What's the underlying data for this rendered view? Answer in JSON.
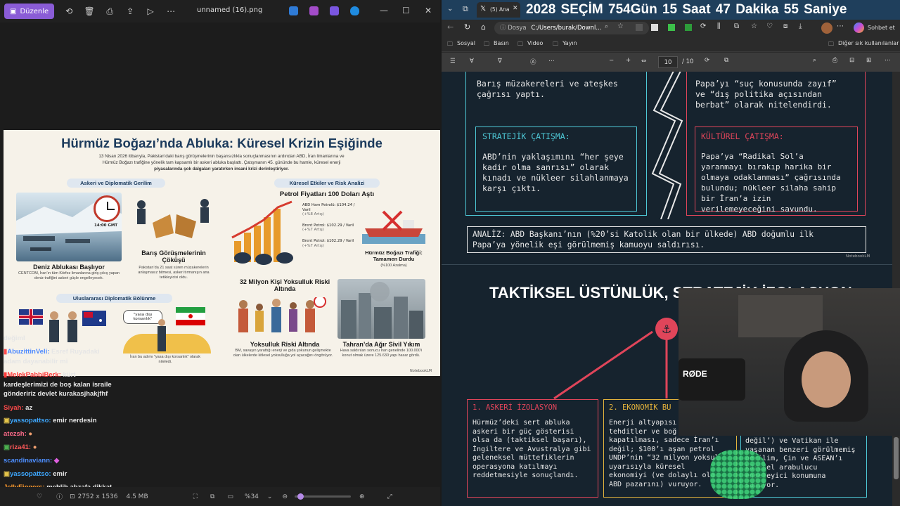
{
  "photos": {
    "edit_label": "Düzenle",
    "file_title": "unnamed (16).png",
    "dimensions": "2752 x 1536",
    "size": "4.5 MB",
    "zoom": "%34",
    "zoom_fraction": 0.05
  },
  "infographic": {
    "title": "Hürmüz Boğazı’nda Abluka: Küresel Krizin Eşiğinde",
    "subtitle_1": "13 Nisan 2026 itibarıyla, Pakistan’daki barış görüşmelerinin başarısızlıkla sonuçlanmasının ardından ABD, İran limanlarına ve",
    "subtitle_2": "Hürmüz Boğazı trafiğine yönelik tam kapsamlı bir askeri abluka başlattı. Çatışmanın 45. gününde bu hamle, küresel enerji",
    "subtitle_3": "piyasalarında şok dalgaları yaratırken insani krizi derinleştiriyor.",
    "section_military": "Askeri ve Diplomatik Gerilim",
    "section_global": "Küresel Etkiler ve Risk Analizi",
    "oil_title": "Petrol Fiyatları 100 Doları Aştı",
    "blockade_caption": "Deniz Ablukası Başlıyor",
    "blockade_text": "CENTCOM, İran’ın tüm Körfez limanlarına giriş-çıkış yapan deniz trafiğini askeri güçle engelleyecek.",
    "clock_time": "14:00 GMT",
    "talks_caption": "Barış Görüşmelerinin Çöküşü",
    "talks_text": "Pakistan’da 21 saat süren müzakerelerin anlaşmasız bitmesi, askeri tırmanışın ana tetikleyicisi oldu.",
    "wti": "ABD Ham Petrolü: $104.24 / Varil",
    "wti_change": "(+%8 Artış)",
    "brent1": "Brent Petrol: $102.29 / Varil",
    "brent1_change": "(+%7 Artış)",
    "brent2": "Brent Petrol: $102.29 / Varil",
    "brent2_change": "(+%7 Artış)",
    "traffic_caption": "Hürmüz Boğazı Trafiği: Tamamen Durdu",
    "traffic_text": "(%100 Azalma)",
    "section_diplomacy": "Uluslararası Diplomatik Bölünme",
    "piracy_bubble": "\"yasa dışı korsanlık\"",
    "piracy_text": "İran bu adımı \"yasa dışı korsanlık\" olarak niteledi.",
    "allies_text": "İngiltere ve Avustralya ablukaya katılmayı reddederken",
    "poverty_title": "32 Milyon Kişi Yoksulluk Riski Altında",
    "poverty_caption": "Yoksulluk Riski Altında",
    "poverty_text": "BM, savaşın yarattığı enerji ve gıda şokunun gelişmekte olan ülkelerde kitlesel yoksulluğa yol açacağını öngörüyor.",
    "tehran_caption": "Tahran’da Ağır Sivil Yıkım",
    "tehran_text": "Hava saldırıları sonucu İran genelinde 100.000’i konut olmak üzere 125.630 yapı hasar gördü.",
    "watermark": "NotebookLM"
  },
  "chat": [
    {
      "user": "",
      "text": "değiml",
      "color": "#ffffff"
    },
    {
      "user": "AbuzittinVeli:",
      "text": "Esref Ruyadaki",
      "color": "#f0f0f0",
      "ucolor": "#4f8bff"
    },
    {
      "user": "",
      "text": "adam dayanabilir mi",
      "color": "#ffffff"
    },
    {
      "user": "MelekPabbiBerk:",
      "text": "kürt",
      "color": "#ffffff",
      "ucolor": "#ff3b3b"
    },
    {
      "user": "",
      "text": "kardeşlerimizi de boş kalan israile",
      "color": "#ffffff"
    },
    {
      "user": "",
      "text": "göndeririz devlet kurakasjhakjfhf",
      "color": "#ffffff"
    },
    {
      "user": "Siyah:",
      "text": "az",
      "color": "#ffffff",
      "ucolor": "#ff4a4a"
    },
    {
      "user": "yassopattso:",
      "text": "emir nerdesin",
      "color": "#ffffff",
      "ucolor": "#3ea8ff"
    },
    {
      "user": "atezsh:",
      "text": "",
      "color": "#ffffff",
      "ucolor": "#ff6b8a"
    },
    {
      "user": "riza41:",
      "text": "",
      "color": "#ffffff",
      "ucolor": "#ff5959"
    },
    {
      "user": "scandinaviann:",
      "text": "",
      "color": "#ffffff",
      "ucolor": "#4d8eff"
    },
    {
      "user": "yassopattso:",
      "text": "emir",
      "color": "#ffffff",
      "ucolor": "#3ea8ff"
    },
    {
      "user": "JellyFingers:",
      "text": "mehlih abzafa dikkat",
      "color": "#ffffff",
      "ucolor": "#ff9a2e"
    },
    {
      "user": "",
      "text": "edin",
      "color": "#ffffff"
    }
  ],
  "browser": {
    "tab_label": "(5) Ana",
    "countdown": "2028 SEÇİM 754Gün 15 Saat 47 Dakika 55 Saniye",
    "address_prefix": "Dosya",
    "address": "C:/Users/burak/Downl...",
    "copilot": "Sohbet et",
    "favorites": [
      "Sosyal",
      "Basın",
      "Video",
      "Yayın"
    ],
    "other_favorites": "Diğer sık kullanılanlar",
    "page_current": "10",
    "page_total": "/ 10"
  },
  "pdf": {
    "top_left_text": "Barış müzakereleri ve ateşkes\nçağrısı yaptı.",
    "top_right_text": "Papa’yı “suç konusunda zayıf”\nve “dış politika açısından\nberbat” olarak nitelendirdi.",
    "strategic_title": "STRATEJİK ÇATIŞMA:",
    "strategic_text": "ABD’nin yaklaşımını “her şeye\nkadir olma sanrısı” olarak\nkınadı ve nükleer silahlanmaya\nkarşı çıktı.",
    "cultural_title": "KÜLTÜREL ÇATIŞMA:",
    "cultural_text": "Papa’ya “Radikal Sol’a\nyaranmayı bırakıp harika bir\nolmaya odaklanması” çağrısında\nbulundu; nükleer silaha sahip\nbir İran’a izin\nverilemeyeceğini savundu.",
    "analysis_text": "ANALİZ: ABD Başkanı’nın (%20’si Katolik olan bir ülkede) ABD doğumlu ilk\nPapa’ya yönelik eşi görülmemiş kamuoyu saldırısı.",
    "section2_title": "TAKTİKSEL ÜSTÜNLÜK, STRATEJİK İZOLASYON",
    "col1_title": "1. ASKERİ İZOLASYON",
    "col1_text": "Hürmüz’deki sert abluka\naskeri bir güç gösterisi\nolsa da (taktiksel başarı),\nİngiltere ve Avustralya gibi\ngeleneksel müttefiklerin\noperasyona katılmayı\nreddetmesiyle sonuçlandı.",
    "col2_title": "2. EKONOMİK BU",
    "col2_text": "Enerji altyapısı\ntehditler ve boğ\nkapatılması, sadece İran’ı\ndeğil; $100’ı aşan petrol\nUNDP’nin “32 milyon yoksul\nuyarısıyla küresel\nekonomiyi (ve dolaylı ola\nABD pazarını) vuruyor.",
    "col3_text": "değil’) ve Vatikan ile\nyaşanan benzeri görülmemiş\ngerilim, Çin ve ASEAN’ı\nküresel arabulucu\nengeleyici konumuna\nsunuyor.",
    "watermark": "NotebookLM"
  },
  "webcam": {
    "mic_brand": "RØDE"
  },
  "colors": {
    "cyan": "#4ec8d6",
    "red": "#e0455a",
    "gold": "#e2b23c",
    "navy": "#1b3a5c"
  }
}
